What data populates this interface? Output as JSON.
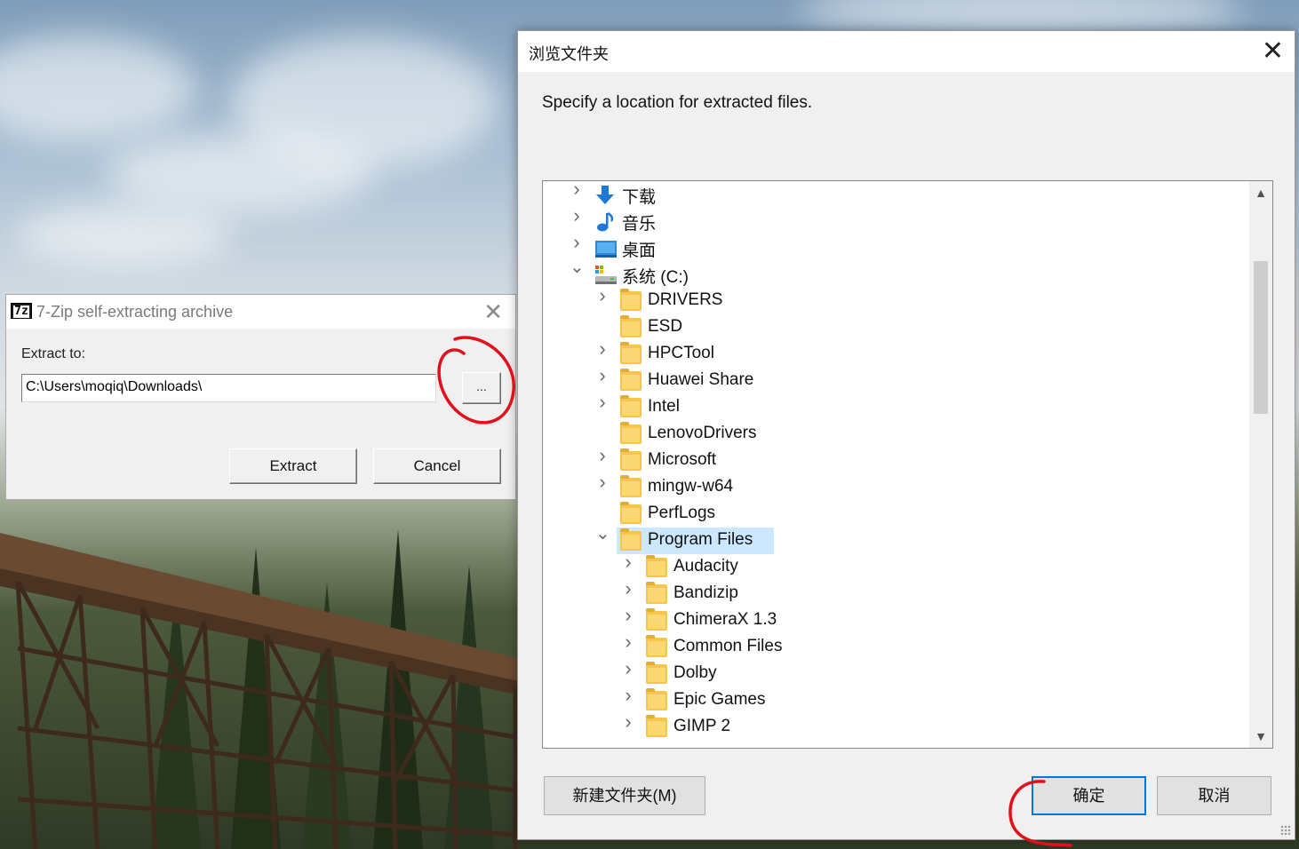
{
  "zip_dialog": {
    "title": "7-Zip self-extracting archive",
    "icon_text": "7z",
    "extract_label": "Extract to:",
    "path_value": "C:\\Users\\moqiq\\Downloads\\",
    "browse_label": "...",
    "extract_button": "Extract",
    "cancel_button": "Cancel",
    "close_glyph": "✕"
  },
  "browse_dialog": {
    "title": "浏览文件夹",
    "close_glyph": "✕",
    "description": "Specify a location for extracted files.",
    "tree": [
      {
        "label": "下载",
        "icon": "download-icon",
        "level": 0,
        "chevron": "right"
      },
      {
        "label": "音乐",
        "icon": "music-icon",
        "level": 0,
        "chevron": "right"
      },
      {
        "label": "桌面",
        "icon": "desktop-icon",
        "level": 0,
        "chevron": "right"
      },
      {
        "label": "系统 (C:)",
        "icon": "drive-icon",
        "level": 0,
        "chevron": "down"
      },
      {
        "label": "DRIVERS",
        "icon": "folder-icon",
        "level": 1,
        "chevron": "right"
      },
      {
        "label": "ESD",
        "icon": "folder-icon",
        "level": 1,
        "chevron": "none"
      },
      {
        "label": "HPCTool",
        "icon": "folder-icon",
        "level": 1,
        "chevron": "right"
      },
      {
        "label": "Huawei Share",
        "icon": "folder-icon",
        "level": 1,
        "chevron": "right"
      },
      {
        "label": "Intel",
        "icon": "folder-icon",
        "level": 1,
        "chevron": "right"
      },
      {
        "label": "LenovoDrivers",
        "icon": "folder-icon",
        "level": 1,
        "chevron": "none"
      },
      {
        "label": "Microsoft",
        "icon": "folder-icon",
        "level": 1,
        "chevron": "right"
      },
      {
        "label": "mingw-w64",
        "icon": "folder-icon",
        "level": 1,
        "chevron": "right"
      },
      {
        "label": "PerfLogs",
        "icon": "folder-icon",
        "level": 1,
        "chevron": "none"
      },
      {
        "label": "Program Files",
        "icon": "folder-icon",
        "level": 1,
        "chevron": "down",
        "selected": true
      },
      {
        "label": "Audacity",
        "icon": "folder-icon",
        "level": 2,
        "chevron": "right"
      },
      {
        "label": "Bandizip",
        "icon": "folder-icon",
        "level": 2,
        "chevron": "right"
      },
      {
        "label": "ChimeraX 1.3",
        "icon": "folder-icon",
        "level": 2,
        "chevron": "right"
      },
      {
        "label": "Common Files",
        "icon": "folder-icon",
        "level": 2,
        "chevron": "right"
      },
      {
        "label": "Dolby",
        "icon": "folder-icon",
        "level": 2,
        "chevron": "right"
      },
      {
        "label": "Epic Games",
        "icon": "folder-icon",
        "level": 2,
        "chevron": "right"
      },
      {
        "label": "GIMP 2",
        "icon": "folder-icon",
        "level": 2,
        "chevron": "right"
      }
    ],
    "new_folder_button": "新建文件夹(M)",
    "ok_button": "确定",
    "cancel_button": "取消"
  },
  "colors": {
    "selection": "#cce8ff",
    "ok_border": "#0078d7",
    "annotation": "#e0111b",
    "folder": "#f5c64e"
  }
}
